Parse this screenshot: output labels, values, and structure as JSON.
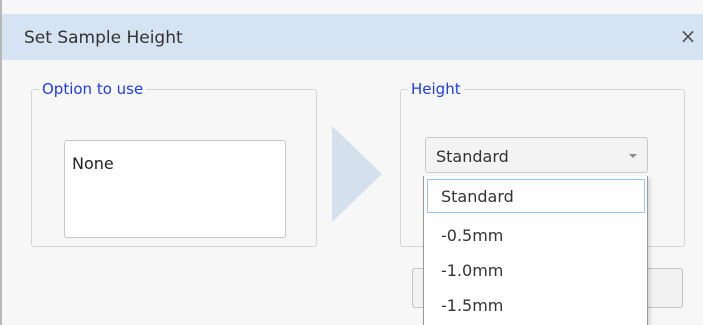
{
  "dialog": {
    "title": "Set Sample Height",
    "close_glyph": "×"
  },
  "option_group": {
    "label": "Option to use",
    "items": [
      "None"
    ]
  },
  "height_group": {
    "label": "Height",
    "selected_value": "Standard",
    "options": [
      "Standard",
      "-0.5mm",
      "-1.0mm",
      "-1.5mm"
    ]
  },
  "icons": {
    "close": "close-icon",
    "arrow": "arrow-right-icon",
    "chevron": "chevron-down-icon"
  },
  "colors": {
    "title_bar": "#d6e3f3",
    "group_label": "#1e3cf0",
    "arrow": "#d4e0ee",
    "selection_border": "#9fc3ec"
  }
}
